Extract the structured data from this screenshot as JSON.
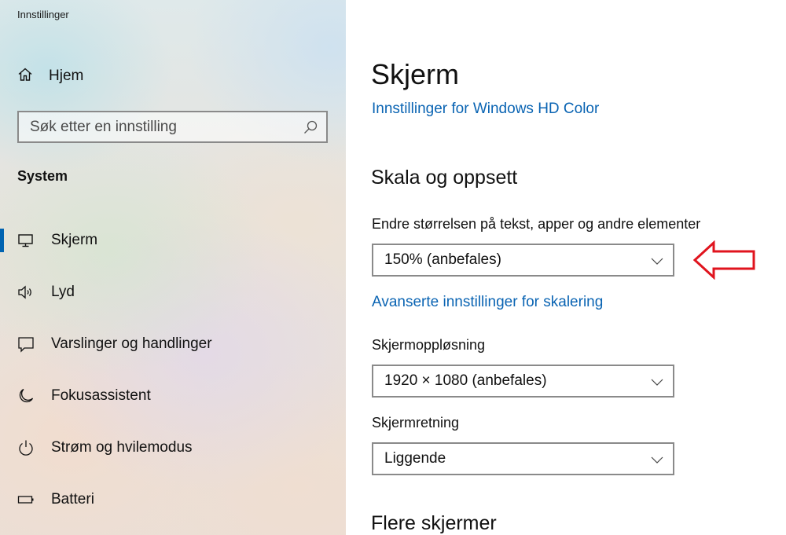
{
  "window": {
    "title": "Innstillinger"
  },
  "sidebar": {
    "home_label": "Hjem",
    "search_placeholder": "Søk etter en innstilling",
    "section_title": "System",
    "items": [
      {
        "label": "Skjerm",
        "icon": "monitor-icon",
        "active": true
      },
      {
        "label": "Lyd",
        "icon": "speaker-icon",
        "active": false
      },
      {
        "label": "Varslinger og handlinger",
        "icon": "notification-icon",
        "active": false
      },
      {
        "label": "Fokusassistent",
        "icon": "moon-icon",
        "active": false
      },
      {
        "label": "Strøm og hvilemodus",
        "icon": "power-icon",
        "active": false
      },
      {
        "label": "Batteri",
        "icon": "battery-icon",
        "active": false
      }
    ]
  },
  "main": {
    "title": "Skjerm",
    "hd_color_link": "Innstillinger for Windows HD Color",
    "scale_section_title": "Skala og oppsett",
    "scale_label": "Endre størrelsen på tekst, apper og andre elementer",
    "scale_value": "150% (anbefales)",
    "advanced_scaling_link": "Avanserte innstillinger for skalering",
    "resolution_label": "Skjermoppløsning",
    "resolution_value": "1920 × 1080 (anbefales)",
    "orientation_label": "Skjermretning",
    "orientation_value": "Liggende",
    "multiple_displays_title": "Flere skjermer"
  },
  "colors": {
    "accent": "#0063b1",
    "link": "#0a64b3",
    "annotation_arrow": "#e0141e"
  }
}
